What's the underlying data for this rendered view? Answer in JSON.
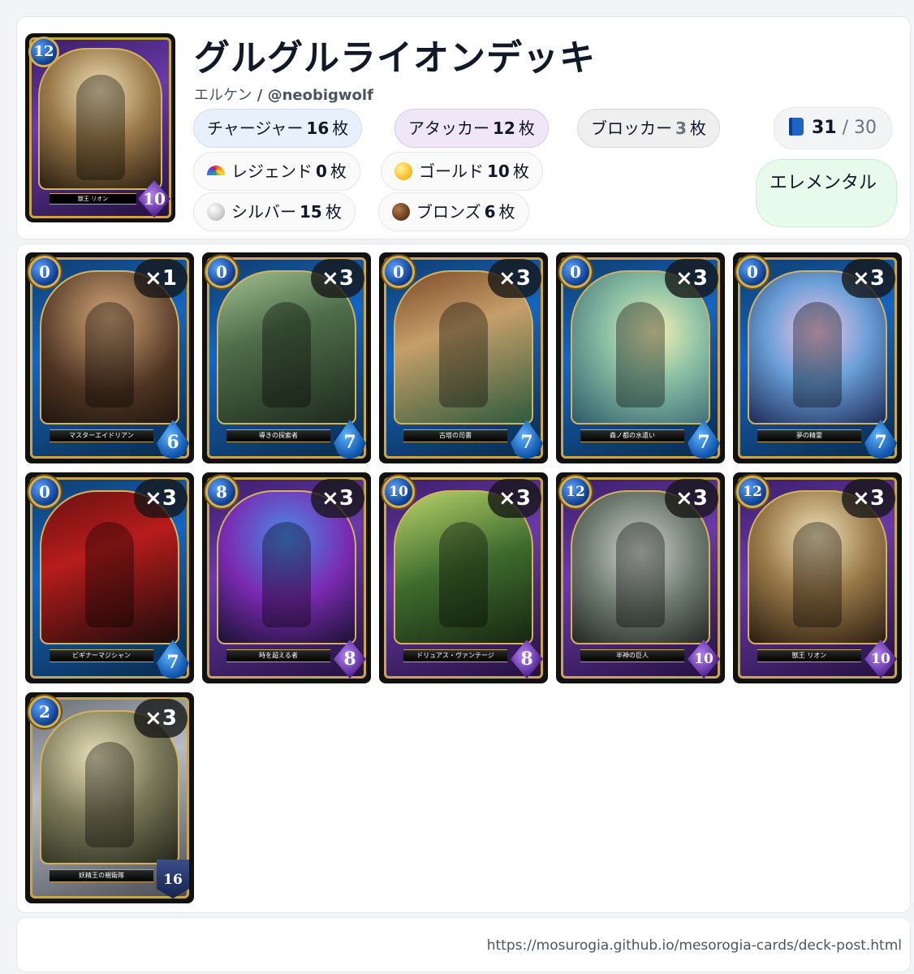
{
  "deck": {
    "title": "グルグルライオンデッキ",
    "author_name": "エルケン",
    "author_sep": " / ",
    "author_handle": "@neobigwolf",
    "hero": {
      "cost": "12",
      "power": "10",
      "name": "獣王 リオン"
    }
  },
  "roles": {
    "charger": {
      "label": "チャージャー",
      "count": "16",
      "unit": "枚"
    },
    "attacker": {
      "label": "アタッカー",
      "count": "12",
      "unit": "枚"
    },
    "blocker": {
      "label": "ブロッカー",
      "count": "3",
      "unit": "枚"
    }
  },
  "rarity": {
    "legend": {
      "label": "レジェンド",
      "count": "0",
      "unit": "枚",
      "icon": "rainbow-icon"
    },
    "gold": {
      "label": "ゴールド",
      "count": "10",
      "unit": "枚",
      "icon": "gold-circle-icon"
    },
    "silver": {
      "label": "シルバー",
      "count": "15",
      "unit": "枚",
      "icon": "silver-circle-icon"
    },
    "bronze": {
      "label": "ブロンズ",
      "count": "6",
      "unit": "枚",
      "icon": "bronze-circle-icon"
    }
  },
  "card_count": {
    "current": "31",
    "max": "/ 30",
    "icon": "book-icon"
  },
  "element": "エレメンタル",
  "cards": [
    {
      "cost": "0",
      "power": "6",
      "name": "マスターエイドリアン",
      "count": "×1",
      "frame": "blue"
    },
    {
      "cost": "0",
      "power": "7",
      "name": "導きの探索者",
      "count": "×3",
      "frame": "blue"
    },
    {
      "cost": "0",
      "power": "7",
      "name": "古塔の司書",
      "count": "×3",
      "frame": "blue"
    },
    {
      "cost": "0",
      "power": "7",
      "name": "森ノ都の水遣い",
      "count": "×3",
      "frame": "blue"
    },
    {
      "cost": "0",
      "power": "7",
      "name": "夢の精霊",
      "count": "×3",
      "frame": "blue"
    },
    {
      "cost": "0",
      "power": "7",
      "name": "ビギナーマジシャン",
      "count": "×3",
      "frame": "blue"
    },
    {
      "cost": "8",
      "power": "8",
      "name": "時を超える者",
      "count": "×3",
      "frame": "purple"
    },
    {
      "cost": "10",
      "power": "8",
      "name": "ドリュアス・ヴァンテージ",
      "count": "×3",
      "frame": "purple"
    },
    {
      "cost": "12",
      "power": "10",
      "name": "半神の巨人",
      "count": "×3",
      "frame": "purple"
    },
    {
      "cost": "12",
      "power": "10",
      "name": "獣王 リオン",
      "count": "×3",
      "frame": "purple"
    },
    {
      "cost": "2",
      "power": "16",
      "name": "妖精王の親衛隊",
      "count": "×3",
      "frame": "silver"
    }
  ],
  "footer": {
    "url": "https://mosurogia.github.io/mesorogia-cards/deck-post.html"
  }
}
